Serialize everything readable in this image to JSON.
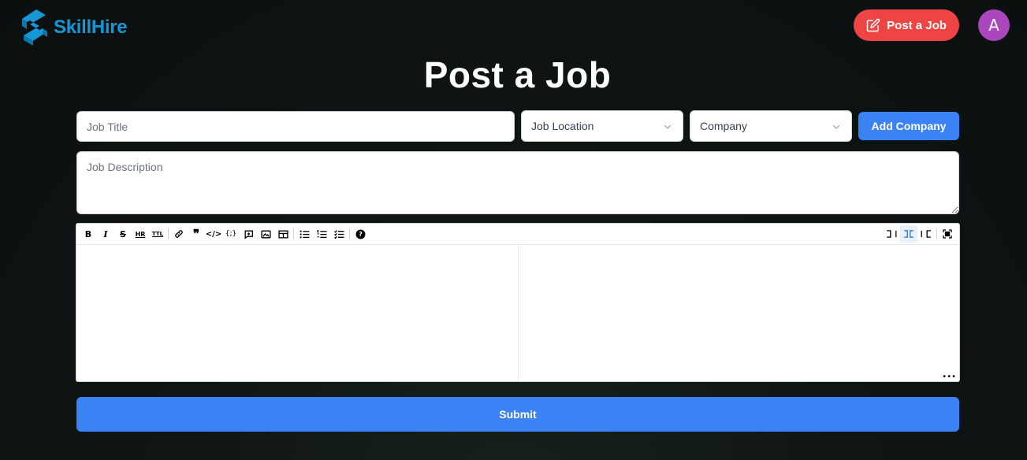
{
  "brand": {
    "name": "SkillHire",
    "color": "#1597d4"
  },
  "header": {
    "post_job_label": "Post a Job",
    "avatar_initial": "A"
  },
  "page": {
    "title": "Post a Job"
  },
  "form": {
    "job_title": {
      "placeholder": "Job Title",
      "value": ""
    },
    "job_location": {
      "selected": "Job Location"
    },
    "company": {
      "selected": "Company"
    },
    "add_company_label": "Add Company",
    "job_description": {
      "placeholder": "Job Description",
      "value": ""
    },
    "submit_label": "Submit"
  },
  "editor": {
    "toolbar_left": [
      "bold-icon",
      "italic-icon",
      "strikethrough-icon",
      "horizontal-rule-icon",
      "title-icon",
      "link-icon",
      "quote-icon",
      "code-icon",
      "code-block-icon",
      "comment-icon",
      "image-icon",
      "table-icon",
      "unordered-list-icon",
      "ordered-list-icon",
      "checked-list-icon",
      "help-icon"
    ],
    "toolbar_right": [
      "edit-mode-icon",
      "live-mode-icon",
      "preview-mode-icon",
      "fullscreen-icon"
    ],
    "active_mode": "live-mode-icon"
  },
  "colors": {
    "accent_red": "#ef4444",
    "accent_blue": "#3b82f6",
    "avatar_purple": "#ab47bc"
  }
}
